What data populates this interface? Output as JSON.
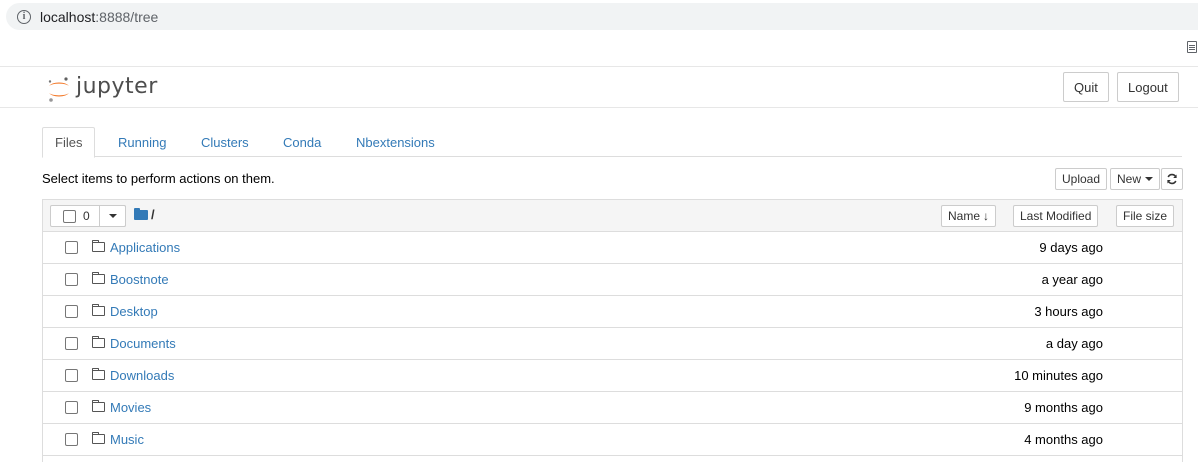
{
  "browser": {
    "url_host": "localhost",
    "url_path": ":8888/tree"
  },
  "header": {
    "logo_text": "jupyter",
    "quit_label": "Quit",
    "logout_label": "Logout"
  },
  "tabs": [
    {
      "label": "Files",
      "active": true
    },
    {
      "label": "Running",
      "active": false
    },
    {
      "label": "Clusters",
      "active": false
    },
    {
      "label": "Conda",
      "active": false
    },
    {
      "label": "Nbextensions",
      "active": false
    }
  ],
  "toolbar": {
    "instructions": "Select items to perform actions on them.",
    "upload_label": "Upload",
    "new_label": "New"
  },
  "list": {
    "selected_count": "0",
    "path": "/",
    "sort_name_label": "Name",
    "sort_modified_label": "Last Modified",
    "sort_size_label": "File size",
    "rows": [
      {
        "name": "Applications",
        "modified": "9 days ago"
      },
      {
        "name": "Boostnote",
        "modified": "a year ago"
      },
      {
        "name": "Desktop",
        "modified": "3 hours ago"
      },
      {
        "name": "Documents",
        "modified": "a day ago"
      },
      {
        "name": "Downloads",
        "modified": "10 minutes ago"
      },
      {
        "name": "Movies",
        "modified": "9 months ago"
      },
      {
        "name": "Music",
        "modified": "4 months ago"
      }
    ]
  },
  "colors": {
    "link": "#337ab7",
    "logo_orange": "#f37726",
    "border": "#dddddd"
  }
}
